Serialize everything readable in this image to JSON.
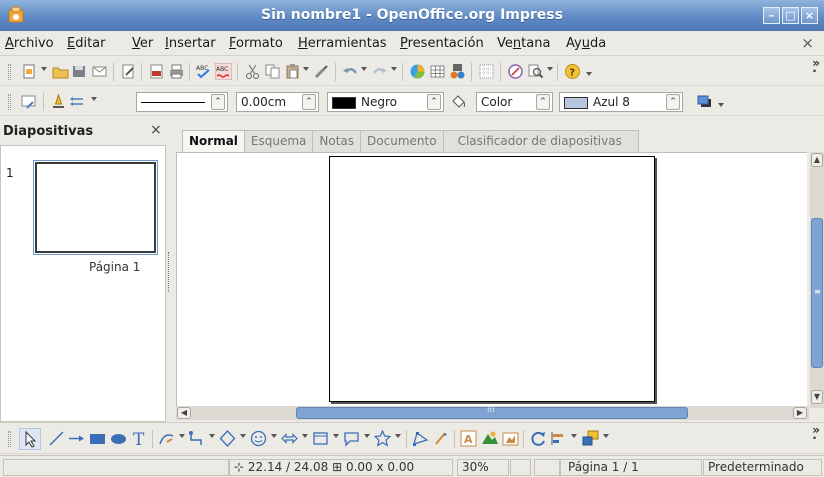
{
  "window": {
    "title": "Sin nombre1 - OpenOffice.org Impress"
  },
  "menubar": {
    "items": [
      {
        "pre": "",
        "u": "A",
        "post": "rchivo"
      },
      {
        "pre": "",
        "u": "E",
        "post": "ditar"
      },
      {
        "pre": "",
        "u": "V",
        "post": "er"
      },
      {
        "pre": "",
        "u": "I",
        "post": "nsertar"
      },
      {
        "pre": "",
        "u": "F",
        "post": "ormato"
      },
      {
        "pre": "",
        "u": "H",
        "post": "erramientas"
      },
      {
        "pre": "",
        "u": "P",
        "post": "resentación"
      },
      {
        "pre": "Ve",
        "u": "n",
        "post": "tana"
      },
      {
        "pre": "Ay",
        "u": "u",
        "post": "da"
      }
    ],
    "close_glyph": "×"
  },
  "line_toolbar": {
    "line_width": "0.00cm",
    "line_color": "Negro",
    "line_color_hex": "#000000",
    "area_style": "Color",
    "area_color": "Azul 8",
    "area_color_hex": "#b4c7dc"
  },
  "slides_pane": {
    "title": "Diapositivas",
    "close_glyph": "×",
    "slide_number": "1",
    "slide_label": "Página 1"
  },
  "tabs": [
    "Normal",
    "Esquema",
    "Notas",
    "Documento",
    "Clasificador de diapositivas"
  ],
  "statusbar": {
    "position": "22.14 / 24.08",
    "size": "0.00 x 0.00",
    "zoom": "30%",
    "page": "Página 1 / 1",
    "layout": "Predeterminado"
  }
}
